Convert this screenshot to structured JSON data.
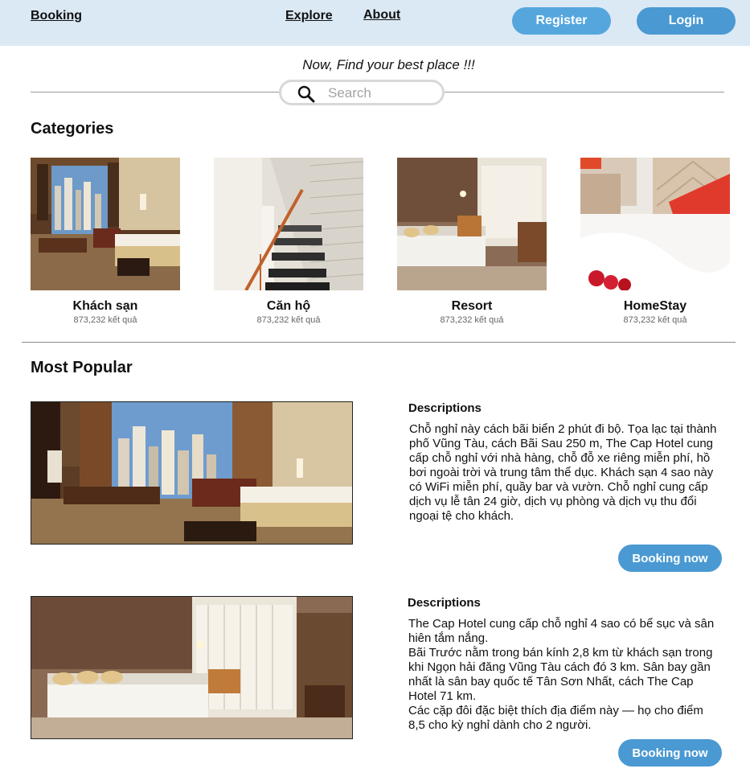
{
  "header": {
    "brand": "Booking",
    "nav": [
      {
        "label": "Explore"
      },
      {
        "label": "About"
      }
    ],
    "register_label": "Register",
    "login_label": "Login"
  },
  "search": {
    "tagline": "Now, Find your best place !!!",
    "placeholder": "Search",
    "icon": "search-icon"
  },
  "categories": {
    "title": "Categories",
    "items": [
      {
        "name": "Khách sạn",
        "count": "873,232 kết quả",
        "image": "hotel-room-photo"
      },
      {
        "name": "Căn hộ",
        "count": "873,232 kết quả",
        "image": "apartment-stairs-photo"
      },
      {
        "name": "Resort",
        "count": "873,232 kết quả",
        "image": "resort-room-photo"
      },
      {
        "name": "HomeStay",
        "count": "873,232 kết quả",
        "image": "homestay-bed-photo"
      }
    ]
  },
  "popular": {
    "title": "Most Popular",
    "items": [
      {
        "desc_title": "Descriptions",
        "description": "Chỗ nghỉ này cách bãi biển 2 phút đi bộ. Tọa lạc tại thành phố Vũng Tàu, cách Bãi Sau 250 m, The Cap Hotel cung cấp chỗ nghỉ với nhà hàng, chỗ đỗ xe riêng miễn phí, hồ bơi ngoài trời và trung tâm thể dục. Khách sạn 4 sao này có WiFi miễn phí, quầy bar và vườn. Chỗ nghỉ cung cấp dịch vụ lễ tân 24 giờ, dịch vụ phòng và dịch vụ thu đổi ngoại tệ cho khách.",
        "button": "Booking now",
        "image": "hotel-room-city-view-photo"
      },
      {
        "desc_title": "Descriptions",
        "description": "The Cap Hotel cung cấp chỗ nghỉ 4 sao có bể sục và sân hiên tắm nắng.\nBãi Trước nằm trong bán kính 2,8 km từ khách sạn trong khi Ngọn hải đăng Vũng Tàu cách đó 3 km. Sân bay gần nhất là sân bay quốc tế Tân Sơn Nhất, cách The Cap Hotel 71 km.\nCác cặp đôi đặc biệt thích địa điểm này — họ cho điểm 8,5 cho kỳ nghỉ dành cho 2 người.",
        "button": "Booking now",
        "image": "hotel-bedroom-photo"
      }
    ]
  },
  "colors": {
    "header_bg": "#dbe9f5",
    "button_blue": "#4a99d2",
    "register_blue": "#56a6de"
  }
}
